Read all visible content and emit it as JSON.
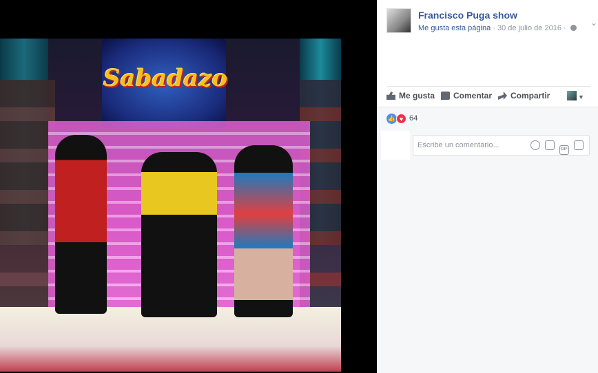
{
  "post": {
    "page_name": "Francisco Puga show",
    "like_page_link": "Me gusta esta página",
    "separator": " · ",
    "date": "30 de julio de 2016",
    "separator2": " · "
  },
  "photo": {
    "sign_text": "Sabadazo"
  },
  "actions": {
    "like_label": "Me gusta",
    "comment_label": "Comentar",
    "share_label": "Compartir"
  },
  "reactions": {
    "count": "64"
  },
  "comment": {
    "placeholder": "Escribe un comentario..."
  },
  "icons": {
    "top_menu": "chevron-down-icon",
    "privacy": "globe-icon",
    "like": "thumbs-up-icon",
    "comment": "comment-icon",
    "share": "share-icon",
    "emoji": "smiley-icon",
    "camera": "camera-icon",
    "gif": "gif-icon",
    "sticker": "sticker-icon"
  },
  "colors": {
    "link": "#365899",
    "meta": "#90949c",
    "like_reaction": "#4a8ef0",
    "love_reaction": "#f0304a"
  }
}
